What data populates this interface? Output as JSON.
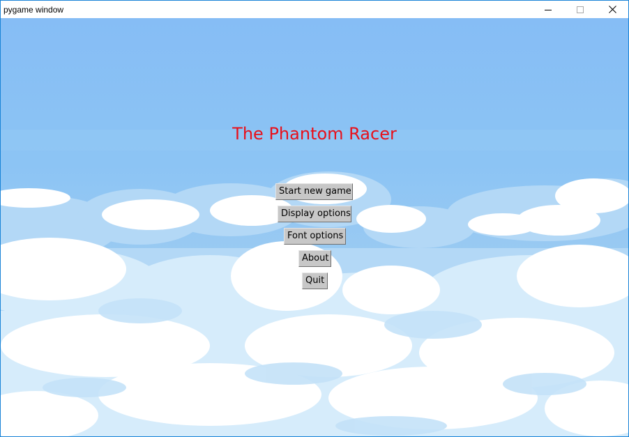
{
  "window": {
    "title": "pygame window"
  },
  "game": {
    "title": "The Phantom Racer",
    "title_color": "#e8101a",
    "background": "sky-with-pixel-clouds"
  },
  "menu": {
    "items": [
      {
        "label": "Start new game"
      },
      {
        "label": "Display options"
      },
      {
        "label": "Font options"
      },
      {
        "label": "About"
      },
      {
        "label": "Quit"
      }
    ]
  },
  "colors": {
    "sky_top": "#86bdf5",
    "sky_bottom": "#8dc3f3",
    "cloud_white": "#ffffff",
    "cloud_light": "#d6ecfb",
    "cloud_mid": "#b3d8f6",
    "button_face": "#c7c7c7"
  },
  "icons": {
    "minimize": "minimize-icon",
    "maximize": "maximize-icon",
    "close": "close-icon"
  }
}
